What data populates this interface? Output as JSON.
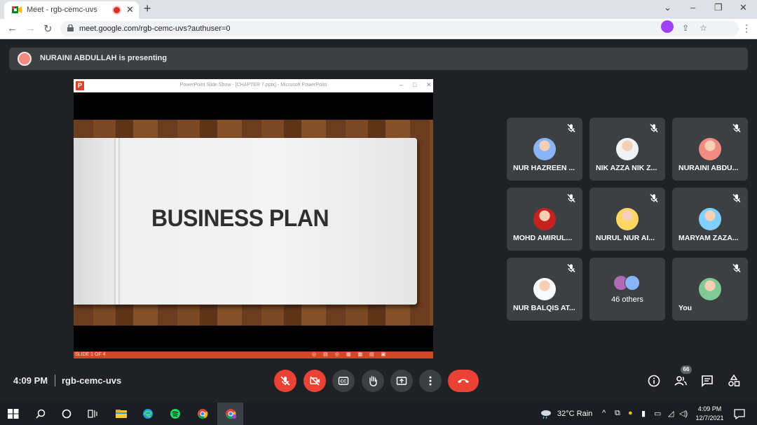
{
  "browser": {
    "tab_title": "Meet - rgb-cemc-uvs",
    "url": "meet.google.com/rgb-cemc-uvs?authuser=0",
    "window_controls": [
      "⌄",
      "–",
      "❐",
      "✕"
    ]
  },
  "banner": {
    "text": "NURAINI ABDULLAH is presenting"
  },
  "presentation": {
    "window_title": "PowerPoint Slide Show - [CHAPTER 7.pptx] - Microsoft PowerPoint",
    "slide_title": "BUSINESS PLAN",
    "status_text": "SLIDE 1 OF 4"
  },
  "participants": [
    {
      "name": "NUR HAZREEN ...",
      "avatar_color": "#8ab4f8"
    },
    {
      "name": "NIK AZZA NIK Z...",
      "avatar_color": "#f1f3f4"
    },
    {
      "name": "NURAINI ABDU...",
      "avatar_color": "#f28b82"
    },
    {
      "name": "MOHD AMIRUL...",
      "avatar_color": "#c5221f"
    },
    {
      "name": "NURUL NUR AI...",
      "avatar_color": "#fdd663"
    },
    {
      "name": "MARYAM ZAZA...",
      "avatar_color": "#7fcfff"
    },
    {
      "name": "NUR BALQIS AT...",
      "avatar_color": "#f8f9fa"
    },
    {
      "name": "You",
      "avatar_color": "#81c995"
    }
  ],
  "others": {
    "label": "46 others"
  },
  "bottom_bar": {
    "time": "4:09 PM",
    "meeting_code": "rgb-cemc-uvs",
    "people_count": "66"
  },
  "taskbar": {
    "weather": "32°C  Rain",
    "time": "4:09 PM",
    "date": "12/7/2021"
  },
  "colors": {
    "meet_background": "#202124",
    "tile_background": "#3c4043",
    "hangup_red": "#ea4335",
    "powerpoint_orange": "#d24726"
  }
}
